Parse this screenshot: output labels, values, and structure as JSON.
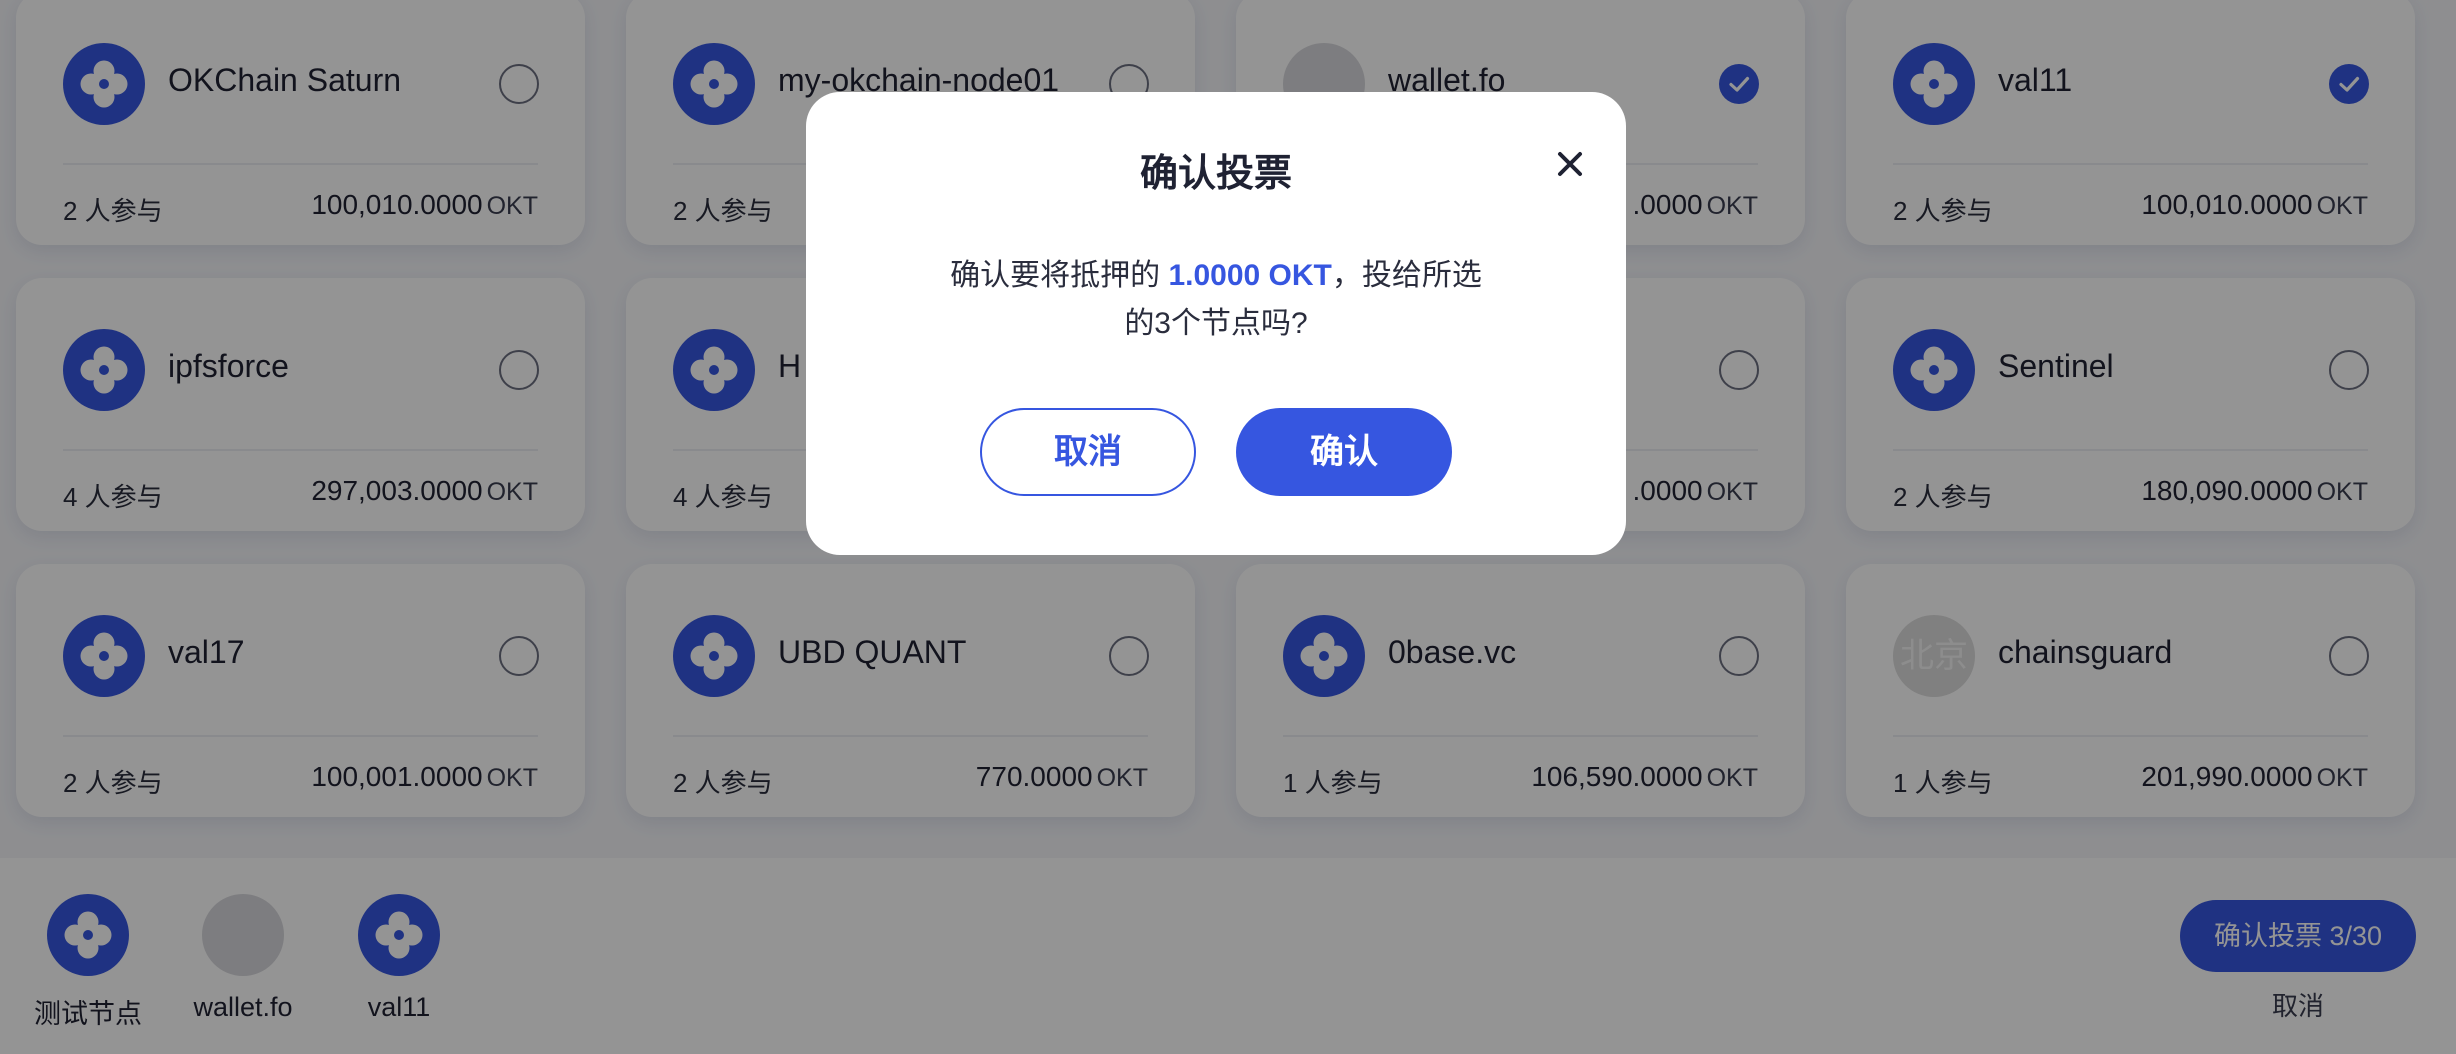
{
  "nodes": [
    {
      "name": "OKChain Saturn",
      "participants": "2 人参与",
      "amount": "100,010.0000",
      "unit": "OKT",
      "logo": "clover-icon",
      "selected": false
    },
    {
      "name": "my-okchain-node01",
      "participants": "2 人参与",
      "amount": "",
      "unit": "",
      "logo": "clover-icon",
      "selected": false
    },
    {
      "name": "wallet.fo",
      "participants": "",
      "amount": ".0000",
      "unit": "OKT",
      "logo": "placeholder-avatar",
      "selected": true
    },
    {
      "name": "val11",
      "participants": "2 人参与",
      "amount": "100,010.0000",
      "unit": "OKT",
      "logo": "clover-icon",
      "selected": true
    },
    {
      "name": "ipfsforce",
      "participants": "4 人参与",
      "amount": "297,003.0000",
      "unit": "OKT",
      "logo": "clover-icon",
      "selected": false
    },
    {
      "name": "H",
      "participants": "4 人参与",
      "amount": "",
      "unit": "",
      "logo": "clover-icon",
      "selected": false
    },
    {
      "name": "",
      "participants": "",
      "amount": ".0000",
      "unit": "OKT",
      "logo": "",
      "selected": false
    },
    {
      "name": "Sentinel",
      "participants": "2 人参与",
      "amount": "180,090.0000",
      "unit": "OKT",
      "logo": "clover-icon",
      "selected": false
    },
    {
      "name": "val17",
      "participants": "2 人参与",
      "amount": "100,001.0000",
      "unit": "OKT",
      "logo": "clover-icon",
      "selected": false
    },
    {
      "name": "UBD QUANT",
      "participants": "2 人参与",
      "amount": "770.0000",
      "unit": "OKT",
      "logo": "clover-icon",
      "selected": false
    },
    {
      "name": "0base.vc",
      "participants": "1 人参与",
      "amount": "106,590.0000",
      "unit": "OKT",
      "logo": "clover-icon",
      "selected": false
    },
    {
      "name": "chainsguard",
      "participants": "1 人参与",
      "amount": "201,990.0000",
      "unit": "OKT",
      "logo": "beijing-logo",
      "logo_text": "北京",
      "selected": false
    }
  ],
  "selection_bar": {
    "items": [
      {
        "label": "测试节点",
        "logo": "clover-icon"
      },
      {
        "label": "wallet.fo",
        "logo": "placeholder-avatar"
      },
      {
        "label": "val11",
        "logo": "clover-icon"
      }
    ],
    "confirm_label": "确认投票 3/30",
    "cancel_label": "取消"
  },
  "modal": {
    "title": "确认投票",
    "message_prefix": "确认要将抵押的 ",
    "message_amount": "1.0000 OKT",
    "message_suffix": "，投给所选的3个节点吗?",
    "cancel_label": "取消",
    "confirm_label": "确认"
  },
  "colors": {
    "accent": "#3656e0",
    "overlay": "rgba(0,0,0,0.42)",
    "card_bg": "#ffffff"
  }
}
